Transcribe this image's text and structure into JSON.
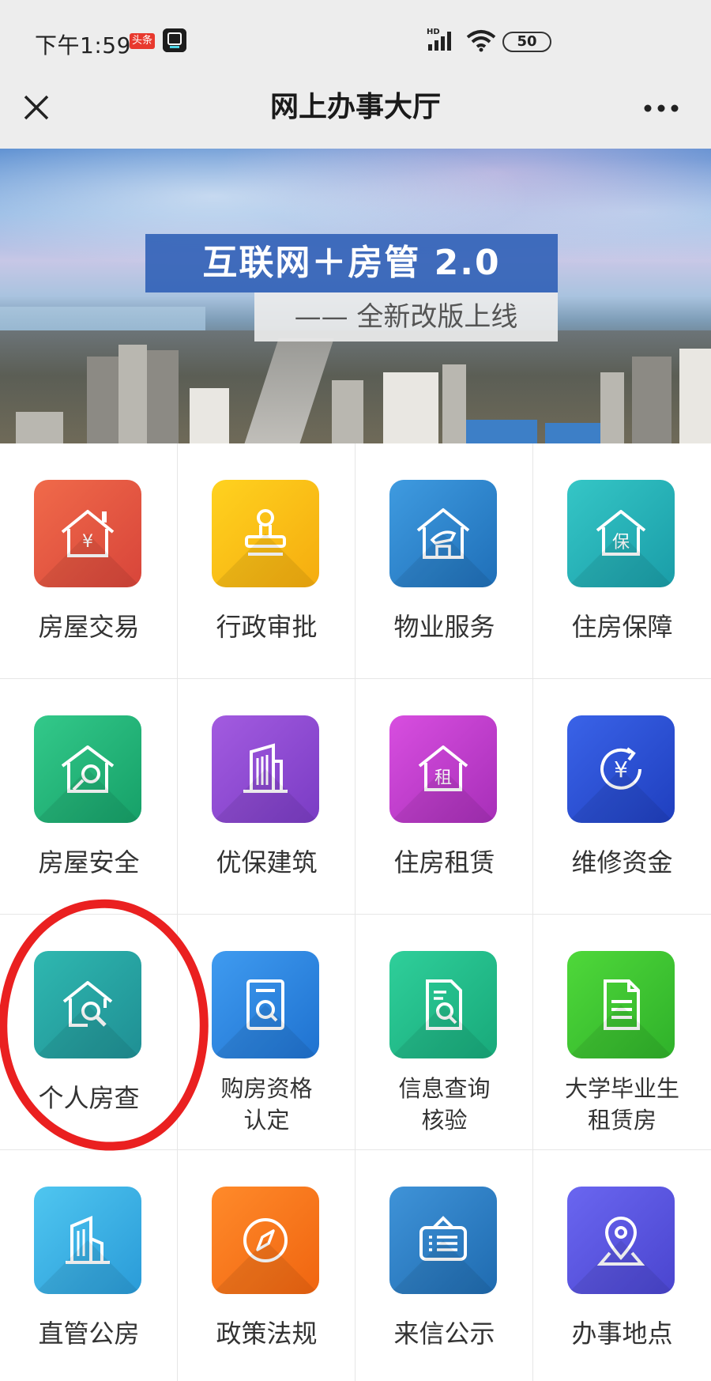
{
  "status_bar": {
    "time": "下午1:59",
    "toutiao_badge": "头条",
    "app_badge": "得物",
    "network": "HD",
    "battery": "50"
  },
  "title_bar": {
    "title": "网上办事大厅",
    "close_icon": "close-icon",
    "more_icon": "more-icon"
  },
  "banner": {
    "title": "互联网＋房管 2.0",
    "subtitle": "—— 全新改版上线"
  },
  "colors": {
    "annotation": "#ea2020"
  },
  "services": [
    {
      "label": "房屋交易",
      "icon": "house-yuan-icon",
      "colors": [
        "#f06a4a",
        "#d8453a"
      ]
    },
    {
      "label": "行政审批",
      "icon": "stamp-icon",
      "colors": [
        "#ffd21f",
        "#f5ac0f"
      ]
    },
    {
      "label": "物业服务",
      "icon": "property-service-icon",
      "colors": [
        "#3f9be0",
        "#1f6fb8"
      ]
    },
    {
      "label": "住房保障",
      "icon": "house-shield-icon",
      "colors": [
        "#35c6c6",
        "#1a9da8"
      ]
    },
    {
      "label": "房屋安全",
      "icon": "house-safety-icon",
      "colors": [
        "#33c98a",
        "#16a068"
      ]
    },
    {
      "label": "优保建筑",
      "icon": "building-icon",
      "colors": [
        "#a35be0",
        "#7a3cc4"
      ]
    },
    {
      "label": "住房租赁",
      "icon": "house-rent-icon",
      "colors": [
        "#d84ee0",
        "#a72fb8"
      ]
    },
    {
      "label": "维修资金",
      "icon": "fund-icon",
      "colors": [
        "#3a63e8",
        "#1f3fbf"
      ]
    },
    {
      "label": "个人房查",
      "icon": "house-search-icon",
      "colors": [
        "#2fb8b0",
        "#1f8f94"
      ]
    },
    {
      "label_line1": "购房资格",
      "label_line2": "认定",
      "icon": "qualification-icon",
      "colors": [
        "#3f9bf0",
        "#1f72d0"
      ]
    },
    {
      "label_line1": "信息查询",
      "label_line2": "核验",
      "icon": "document-search-icon",
      "colors": [
        "#2fcf9a",
        "#18a97a"
      ]
    },
    {
      "label_line1": "大学毕业生",
      "label_line2": "租赁房",
      "icon": "document-icon",
      "colors": [
        "#4fd83a",
        "#2fb12a"
      ]
    },
    {
      "label": "直管公房",
      "icon": "public-housing-icon",
      "colors": [
        "#4fc6f0",
        "#2a9bd8"
      ]
    },
    {
      "label": "政策法规",
      "icon": "compass-icon",
      "colors": [
        "#ff8a2a",
        "#f06510"
      ]
    },
    {
      "label": "来信公示",
      "icon": "notice-board-icon",
      "colors": [
        "#3f93d8",
        "#1f6bb0"
      ]
    },
    {
      "label": "办事地点",
      "icon": "location-icon",
      "colors": [
        "#6a66f0",
        "#4a45cf"
      ]
    }
  ]
}
